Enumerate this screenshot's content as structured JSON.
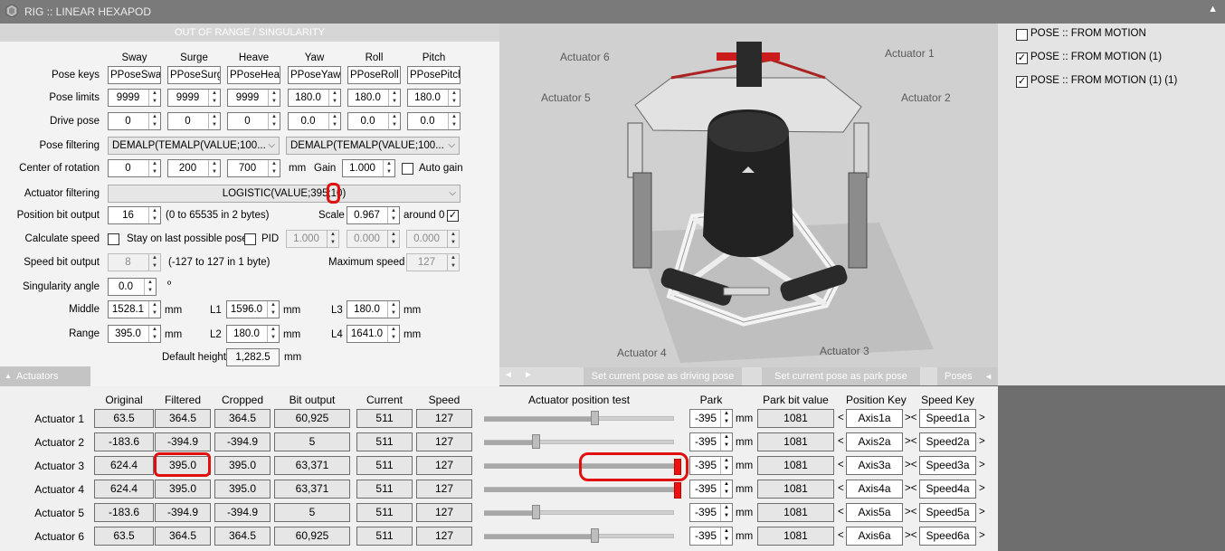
{
  "window": {
    "title": "RIG :: LINEAR HEXAPOD"
  },
  "config": {
    "header": "OUT OF RANGE / SINGULARITY",
    "columns": [
      "Sway",
      "Surge",
      "Heave",
      "Yaw",
      "Roll",
      "Pitch"
    ],
    "pose_keys": {
      "label": "Pose keys",
      "values": [
        "PPoseSway",
        "PPoseSurge",
        "PPoseHeave",
        "PPoseYaw",
        "PPoseRoll",
        "PPosePitch"
      ]
    },
    "pose_limits": {
      "label": "Pose limits",
      "values": [
        "9999",
        "9999",
        "9999",
        "180.0",
        "180.0",
        "180.0"
      ]
    },
    "drive_pose": {
      "label": "Drive pose",
      "values": [
        "0",
        "0",
        "0",
        "0.0",
        "0.0",
        "0.0"
      ]
    },
    "pose_filtering": {
      "label": "Pose filtering",
      "left": "DEMALP(TEMALP(VALUE;100...",
      "right": "DEMALP(TEMALP(VALUE;100..."
    },
    "center_of_rotation": {
      "label": "Center of rotation",
      "values": [
        "0",
        "200",
        "700"
      ],
      "unit": "mm",
      "gain_label": "Gain",
      "gain": "1.000",
      "auto_gain_label": "Auto gain",
      "auto_gain_checked": false
    },
    "actuator_filtering": {
      "label": "Actuator filtering",
      "value": "LOGISTIC(VALUE;395;10)"
    },
    "position_bit_output": {
      "label": "Position bit output",
      "value": "16",
      "note": "(0 to 65535 in 2 bytes)",
      "scale_label": "Scale",
      "scale": "0.967",
      "around_label": "around 0",
      "around_checked": true
    },
    "calculate_speed": {
      "label": "Calculate speed",
      "checked": false,
      "stay_label": "Stay on last possible pose",
      "pid_label": "PID",
      "pid_checked": false,
      "pid_values": [
        "1.000",
        "0.000",
        "0.000"
      ]
    },
    "speed_bit_output": {
      "label": "Speed bit output",
      "value": "8",
      "note": "(-127 to 127 in 1 byte)",
      "max_speed_label": "Maximum speed",
      "max_speed": "127"
    },
    "singularity_angle": {
      "label": "Singularity angle",
      "value": "0.0",
      "unit": "º"
    },
    "middle": {
      "label": "Middle",
      "value": "1528.1",
      "unit": "mm"
    },
    "range": {
      "label": "Range",
      "value": "395.0",
      "unit": "mm"
    },
    "l1": {
      "label": "L1",
      "value": "1596.0",
      "unit": "mm"
    },
    "l2": {
      "label": "L2",
      "value": "180.0",
      "unit": "mm"
    },
    "l3": {
      "label": "L3",
      "value": "180.0",
      "unit": "mm"
    },
    "l4": {
      "label": "L4",
      "value": "1641.0",
      "unit": "mm"
    },
    "default_height": {
      "label": "Default height",
      "value": "1,282.5",
      "unit": "mm"
    }
  },
  "view": {
    "actuator_labels": [
      "Actuator 1",
      "Actuator 2",
      "Actuator 3",
      "Actuator 4",
      "Actuator 5",
      "Actuator 6"
    ]
  },
  "strip": {
    "actuators_tab": "Actuators",
    "prev_arrow": "◄",
    "next_arrow": "►",
    "set_driving": "Set current pose as driving pose",
    "set_park": "Set current pose as park pose",
    "poses_tab": "Poses"
  },
  "right_panel": {
    "items": [
      {
        "label": "POSE :: FROM MOTION",
        "checked": false
      },
      {
        "label": "POSE :: FROM MOTION (1)",
        "checked": true
      },
      {
        "label": "POSE :: FROM MOTION (1) (1)",
        "checked": true
      }
    ]
  },
  "actuators": {
    "headers": {
      "original": "Original",
      "filtered": "Filtered",
      "cropped": "Cropped",
      "bit_output": "Bit output",
      "current": "Current",
      "speed": "Speed",
      "position_test": "Actuator position test",
      "park": "Park",
      "park_bit": "Park bit value",
      "position_key": "Position Key",
      "speed_key": "Speed Key"
    },
    "unit": "mm",
    "rows": [
      {
        "name": "Actuator 1",
        "original": "63.5",
        "filtered": "364.5",
        "cropped": "364.5",
        "bit_output": "60,925",
        "current": "511",
        "speed": "127",
        "test_level": 0.58,
        "park": "-395",
        "park_bit": "1081",
        "position_key": "Axis1a",
        "speed_key": "Speed1a"
      },
      {
        "name": "Actuator 2",
        "original": "-183.6",
        "filtered": "-394.9",
        "cropped": "-394.9",
        "bit_output": "5",
        "current": "511",
        "speed": "127",
        "test_level": 0.27,
        "park": "-395",
        "park_bit": "1081",
        "position_key": "Axis2a",
        "speed_key": "Speed2a"
      },
      {
        "name": "Actuator 3",
        "original": "624.4",
        "filtered": "395.0",
        "cropped": "395.0",
        "bit_output": "63,371",
        "current": "511",
        "speed": "127",
        "test_level": 1.0,
        "park": "-395",
        "park_bit": "1081",
        "position_key": "Axis3a",
        "speed_key": "Speed3a"
      },
      {
        "name": "Actuator 4",
        "original": "624.4",
        "filtered": "395.0",
        "cropped": "395.0",
        "bit_output": "63,371",
        "current": "511",
        "speed": "127",
        "test_level": 1.0,
        "park": "-395",
        "park_bit": "1081",
        "position_key": "Axis4a",
        "speed_key": "Speed4a"
      },
      {
        "name": "Actuator 5",
        "original": "-183.6",
        "filtered": "-394.9",
        "cropped": "-394.9",
        "bit_output": "5",
        "current": "511",
        "speed": "127",
        "test_level": 0.27,
        "park": "-395",
        "park_bit": "1081",
        "position_key": "Axis5a",
        "speed_key": "Speed5a"
      },
      {
        "name": "Actuator 6",
        "original": "63.5",
        "filtered": "364.5",
        "cropped": "364.5",
        "bit_output": "60,925",
        "current": "511",
        "speed": "127",
        "test_level": 0.58,
        "park": "-395",
        "park_bit": "1081",
        "position_key": "Axis6a",
        "speed_key": "Speed6a"
      }
    ]
  }
}
